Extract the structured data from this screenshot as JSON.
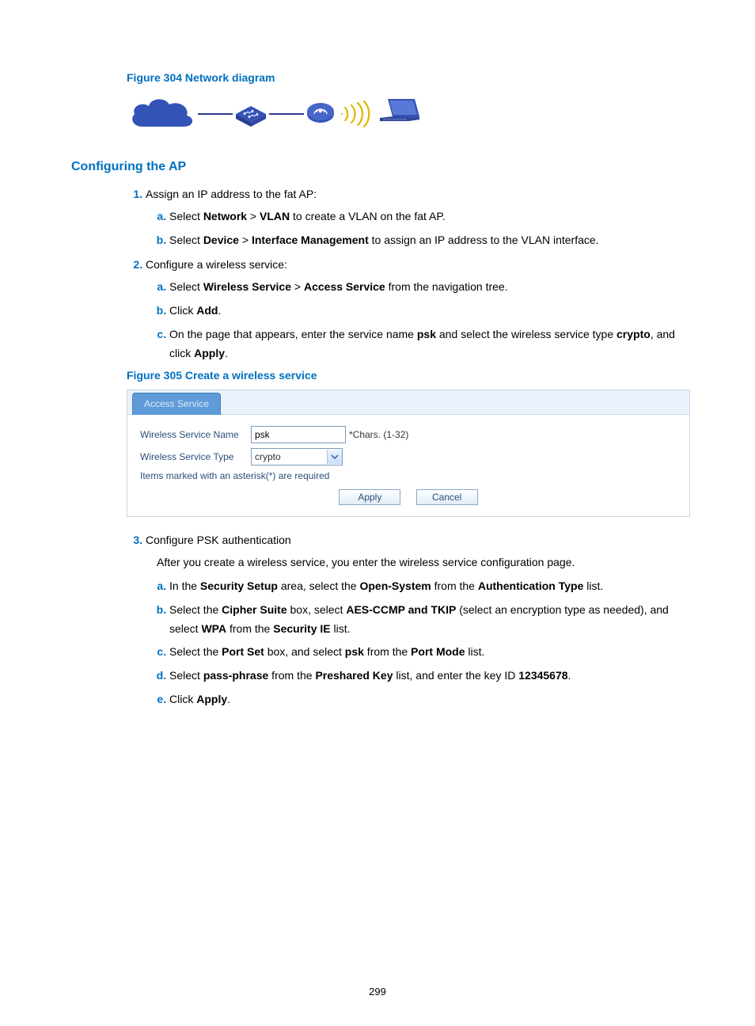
{
  "figures": {
    "f304": "Figure 304 Network diagram",
    "f305": "Figure 305 Create a wireless service"
  },
  "headings": {
    "configuring_ap": "Configuring the AP"
  },
  "steps": {
    "s1": {
      "text": "Assign an IP address to the fat AP:",
      "a": {
        "pre": "Select ",
        "b1": "Network",
        "mid": " > ",
        "b2": "VLAN",
        "post": " to create a VLAN on the fat AP."
      },
      "b": {
        "pre": "Select ",
        "b1": "Device",
        "mid": " > ",
        "b2": "Interface Management",
        "post": " to assign an IP address to the VLAN interface."
      }
    },
    "s2": {
      "text": "Configure a wireless service:",
      "a": {
        "pre": "Select ",
        "b1": "Wireless Service",
        "mid": " > ",
        "b2": "Access Service",
        "post": " from the navigation tree."
      },
      "b": {
        "pre": "Click ",
        "b1": "Add",
        "post": "."
      },
      "c": {
        "pre": "On the page that appears, enter the service name ",
        "b1": "psk",
        "mid": " and select the wireless service type ",
        "b2": "crypto",
        "mid2": ", and click ",
        "b3": "Apply",
        "post": "."
      }
    },
    "s3": {
      "text": "Configure PSK authentication",
      "after": "After you create a wireless service, you enter the wireless service configuration page.",
      "a": {
        "pre": "In the ",
        "b1": "Security Setup",
        "mid": " area, select the ",
        "b2": "Open-System",
        "mid2": " from the ",
        "b3": "Authentication Type",
        "post": " list."
      },
      "b": {
        "pre": "Select the ",
        "b1": "Cipher Suite",
        "mid": " box, select ",
        "b2": "AES-CCMP and TKIP",
        "mid2": " (select an encryption type as needed), and select ",
        "b3": "WPA",
        "mid3": " from the ",
        "b4": "Security IE",
        "post": " list."
      },
      "c": {
        "pre": "Select the ",
        "b1": "Port Set",
        "mid": " box, and select ",
        "b2": "psk",
        "mid2": " from the ",
        "b3": "Port Mode",
        "post": " list."
      },
      "d": {
        "pre": "Select ",
        "b1": "pass-phrase",
        "mid": " from the ",
        "b2": "Preshared Key",
        "mid2": " list, and enter the key ID ",
        "b3": "12345678",
        "post": "."
      },
      "e": {
        "pre": "Click ",
        "b1": "Apply",
        "post": "."
      }
    }
  },
  "ui": {
    "tab": "Access Service",
    "rows": {
      "name_label": "Wireless Service Name",
      "name_value": "psk",
      "name_hint": "*Chars. (1-32)",
      "type_label": "Wireless Service Type",
      "type_value": "crypto"
    },
    "note": "Items marked with an asterisk(*) are required",
    "buttons": {
      "apply": "Apply",
      "cancel": "Cancel"
    }
  },
  "page_number": "299"
}
